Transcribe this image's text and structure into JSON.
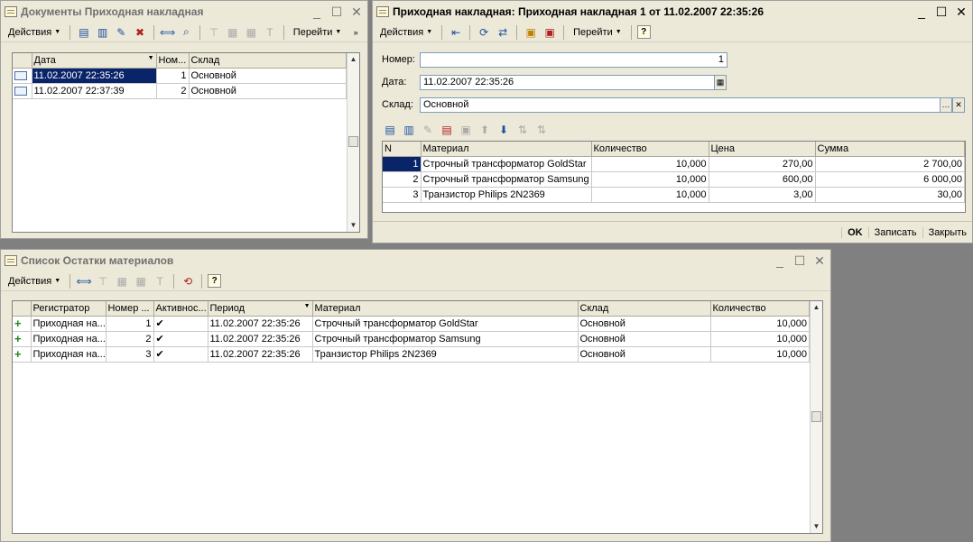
{
  "win_docs": {
    "title": "Документы Приходная накладная",
    "actions_label": "Действия",
    "goto_label": "Перейти",
    "columns": [
      "Дата",
      "Ном...",
      "Склад"
    ],
    "rows": [
      {
        "date": "11.02.2007 22:35:26",
        "num": "1",
        "warehouse": "Основной"
      },
      {
        "date": "11.02.2007 22:37:39",
        "num": "2",
        "warehouse": "Основной"
      }
    ]
  },
  "win_doc": {
    "title": "Приходная накладная: Приходная накладная 1 от 11.02.2007 22:35:26",
    "actions_label": "Действия",
    "goto_label": "Перейти",
    "number_label": "Номер:",
    "number_value": "1",
    "date_label": "Дата:",
    "date_value": "11.02.2007 22:35:26",
    "warehouse_label": "Склад:",
    "warehouse_value": "Основной",
    "columns": [
      "N",
      "Материал",
      "Количество",
      "Цена",
      "Сумма"
    ],
    "rows": [
      {
        "n": "1",
        "material": "Строчный трансформатор GoldStar",
        "qty": "10,000",
        "price": "270,00",
        "sum": "2 700,00"
      },
      {
        "n": "2",
        "material": "Строчный трансформатор Samsung",
        "qty": "10,000",
        "price": "600,00",
        "sum": "6 000,00"
      },
      {
        "n": "3",
        "material": "Транзистор Philips 2N2369",
        "qty": "10,000",
        "price": "3,00",
        "sum": "30,00"
      }
    ],
    "ok_label": "OK",
    "save_label": "Записать",
    "close_label": "Закрыть"
  },
  "win_reg": {
    "title": "Список Остатки материалов",
    "actions_label": "Действия",
    "columns": [
      "Регистратор",
      "Номер ...",
      "Активнос...",
      "Период",
      "Материал",
      "Склад",
      "Количество"
    ],
    "rows": [
      {
        "registrar": "Приходная на...",
        "line": "1",
        "period": "11.02.2007 22:35:26",
        "material": "Строчный трансформатор GoldStar",
        "warehouse": "Основной",
        "qty": "10,000"
      },
      {
        "registrar": "Приходная на...",
        "line": "2",
        "period": "11.02.2007 22:35:26",
        "material": "Строчный трансформатор Samsung",
        "warehouse": "Основной",
        "qty": "10,000"
      },
      {
        "registrar": "Приходная на...",
        "line": "3",
        "period": "11.02.2007 22:35:26",
        "material": "Транзистор Philips 2N2369",
        "warehouse": "Основной",
        "qty": "10,000"
      }
    ]
  }
}
